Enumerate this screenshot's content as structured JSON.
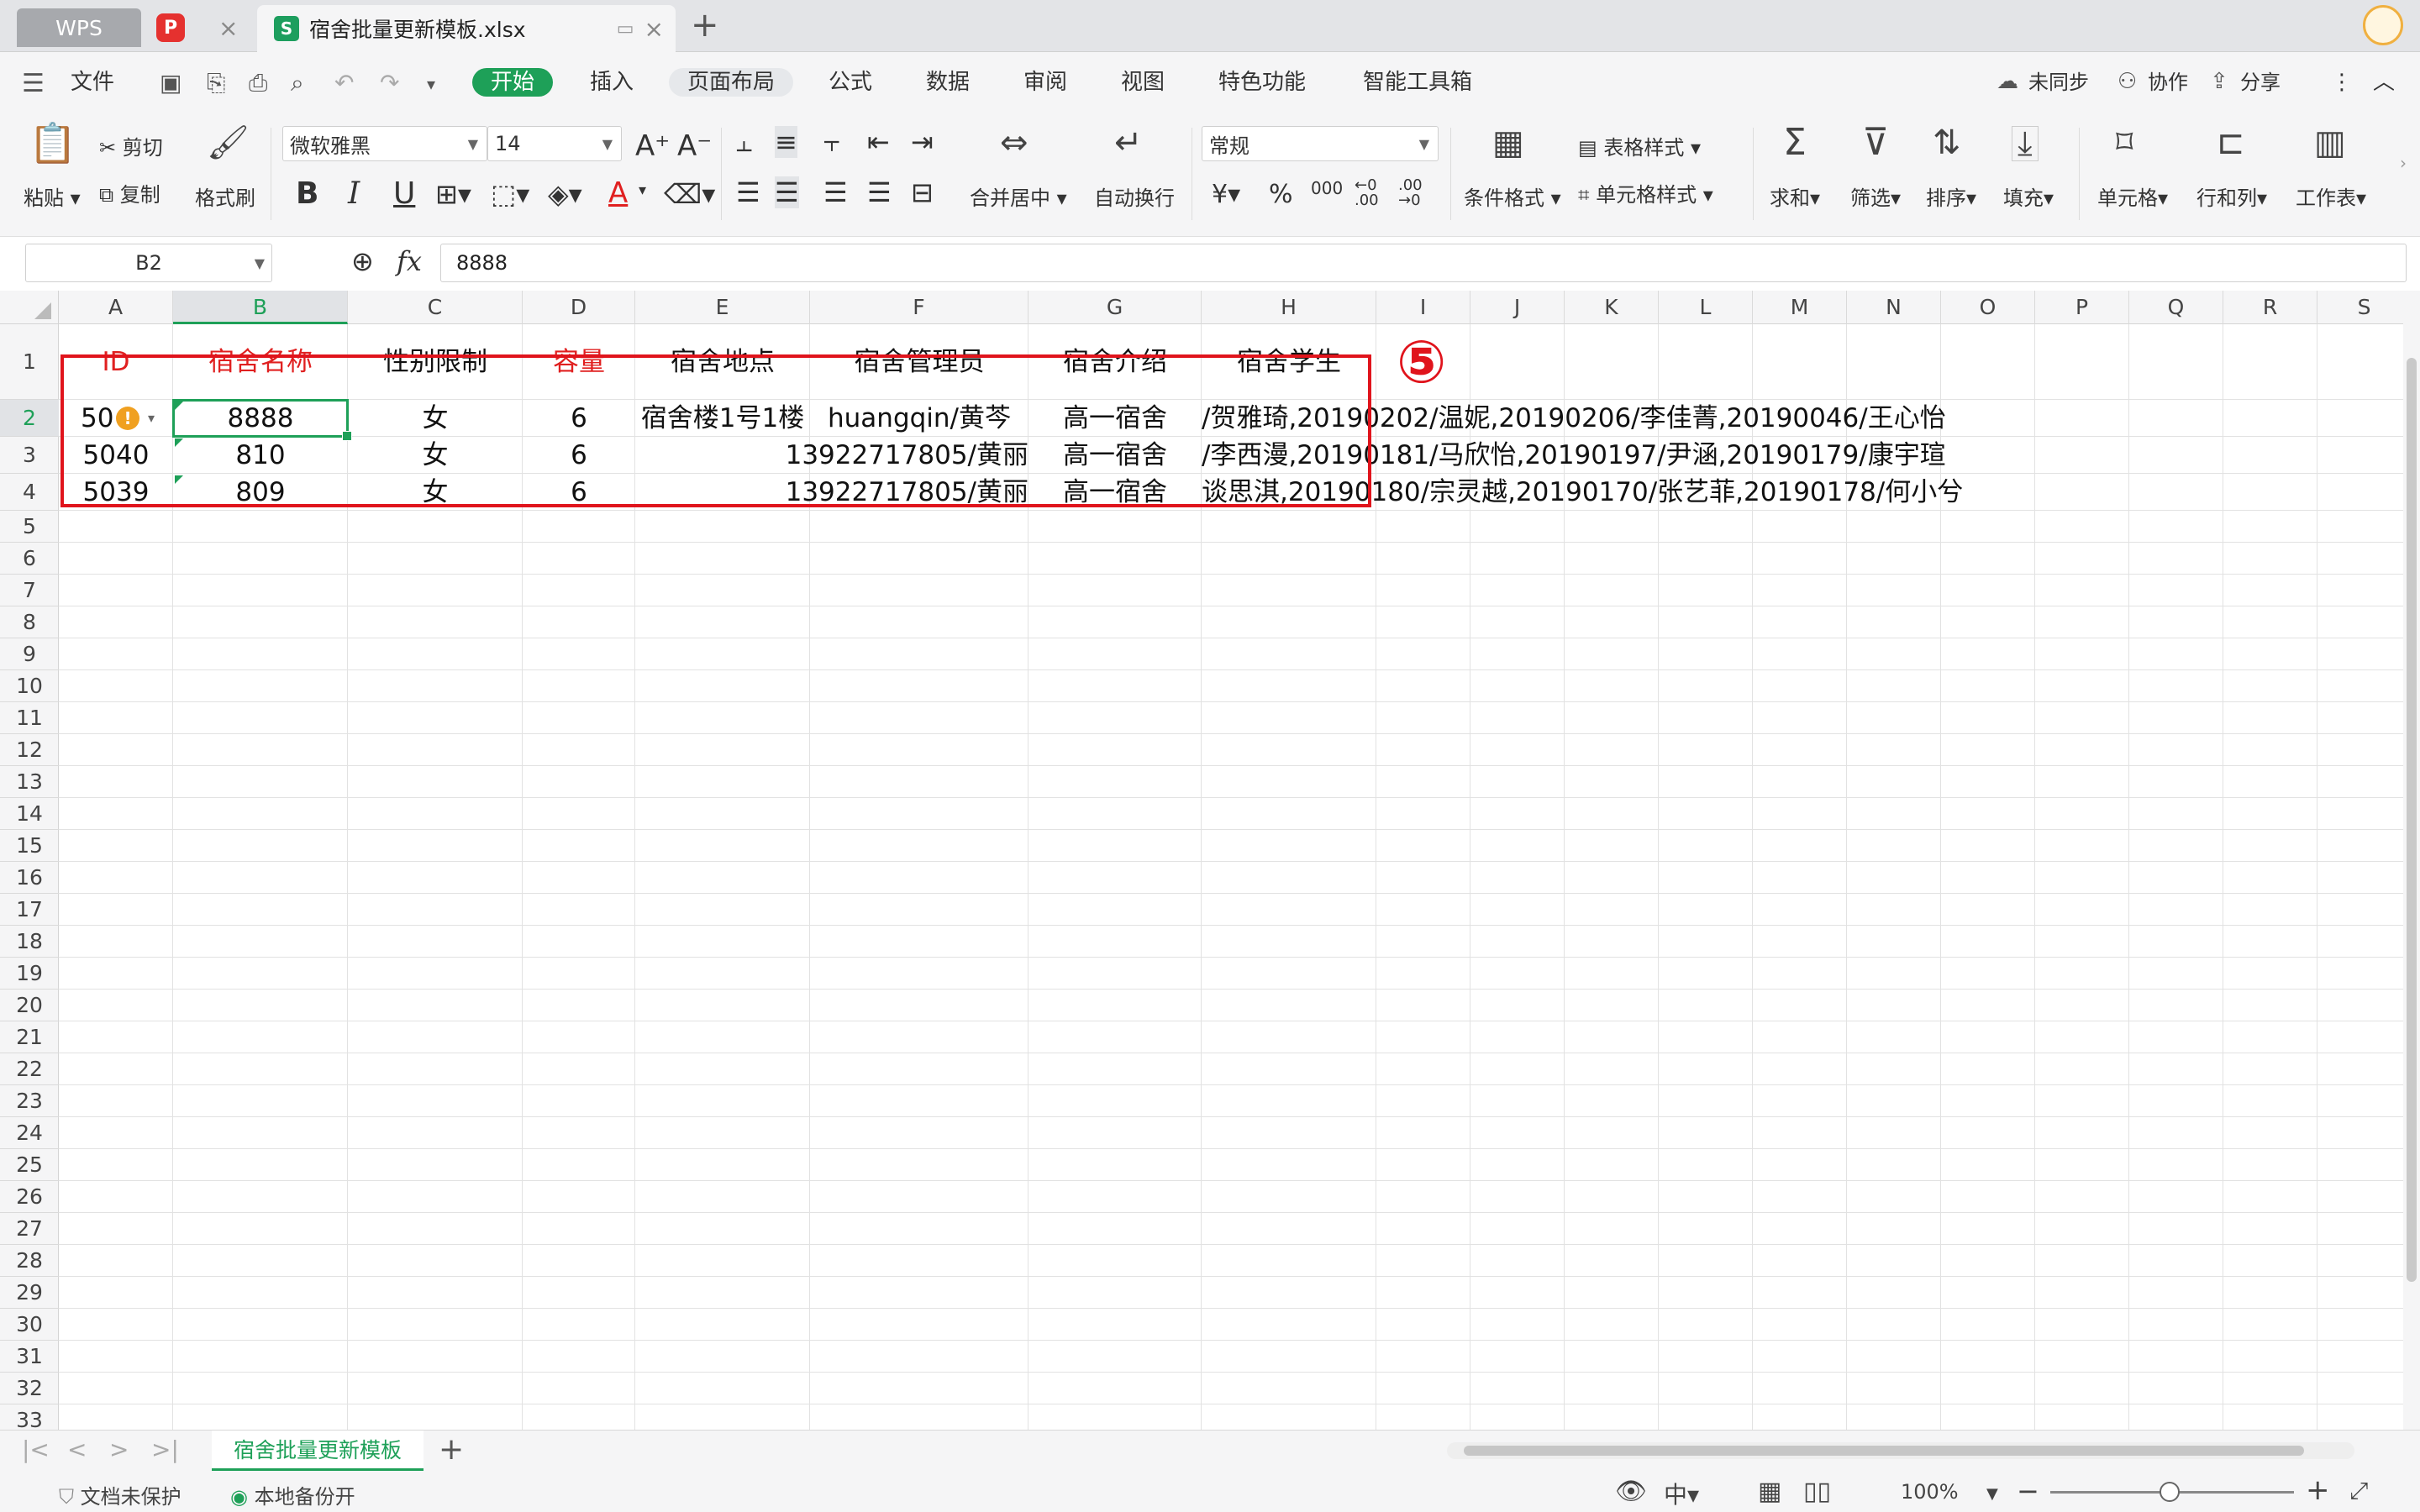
{
  "tabs": {
    "wps": "WPS",
    "pdf_icon": "P",
    "file_icon": "S",
    "file_name": "宿舍批量更新模板.xlsx",
    "close": "×",
    "add": "+"
  },
  "menu": {
    "file": "文件",
    "items": [
      "开始",
      "插入",
      "页面布局",
      "公式",
      "数据",
      "审阅",
      "视图",
      "特色功能",
      "智能工具箱"
    ],
    "sync": "未同步",
    "collab": "协作",
    "share": "分享",
    "more": "⋮",
    "collapse": "︿"
  },
  "ribbon": {
    "paste": "粘贴",
    "cut": "剪切",
    "copy": "复制",
    "format_painter": "格式刷",
    "font_name": "微软雅黑",
    "font_size": "14",
    "bold": "B",
    "italic": "I",
    "underline": "U",
    "merge": "合并居中",
    "wrap": "自动换行",
    "number_format": "常规",
    "currency": "¥",
    "percent": "%",
    "thousands": "000",
    "inc_dec": "←0 .00",
    "dec_dec": ".00 →0",
    "cond_format": "条件格式",
    "table_style": "表格样式",
    "cell_style": "单元格样式",
    "sum": "求和",
    "filter": "筛选",
    "sort": "排序",
    "fill": "填充",
    "cell": "单元格",
    "row_col": "行和列",
    "worksheet": "工作表"
  },
  "formula_bar": {
    "name_box": "B2",
    "fx": "fx",
    "value": "8888"
  },
  "columns": [
    "A",
    "B",
    "C",
    "D",
    "E",
    "F",
    "G",
    "H",
    "I",
    "J",
    "K",
    "L",
    "M",
    "N",
    "O",
    "P",
    "Q",
    "R",
    "S"
  ],
  "rows": [
    "1",
    "2",
    "3",
    "4",
    "5",
    "6",
    "7",
    "8",
    "9",
    "10",
    "11",
    "12",
    "13",
    "14",
    "15",
    "16",
    "17",
    "18",
    "19",
    "20",
    "21",
    "22",
    "23",
    "24",
    "25",
    "26",
    "27",
    "28",
    "29",
    "30",
    "31",
    "32",
    "33"
  ],
  "table": {
    "headers": [
      "ID",
      "宿舍名称",
      "性别限制",
      "容量",
      "宿舍地点",
      "宿舍管理员",
      "宿舍介绍",
      "宿舍学生"
    ],
    "rows": [
      [
        "50",
        "8888",
        "女",
        "6",
        "宿舍楼1号1楼",
        "huangqin/黄芩",
        "高一宿舍",
        "/贺雅琦,20190202/温妮,20190206/李佳菁,20190046/王心怡"
      ],
      [
        "5040",
        "810",
        "女",
        "6",
        "",
        "13922717805/黄丽",
        "高一宿舍",
        "/李西漫,20190181/马欣怡,20190197/尹涵,20190179/康宇瑄"
      ],
      [
        "5039",
        "809",
        "女",
        "6",
        "",
        "13922717805/黄丽",
        "高一宿舍",
        "谈思淇,20190180/宗灵越,20190170/张艺菲,20190178/何小兮"
      ]
    ],
    "warning_icon": "!"
  },
  "annotation": "⑤",
  "sheet": {
    "nav": [
      "|<",
      "<",
      ">",
      ">|"
    ],
    "active": "宿舍批量更新模板",
    "add": "+"
  },
  "status": {
    "protect": "文档未保护",
    "backup": "本地备份开",
    "zoom": "100%",
    "zoom_minus": "−",
    "zoom_plus": "+"
  }
}
